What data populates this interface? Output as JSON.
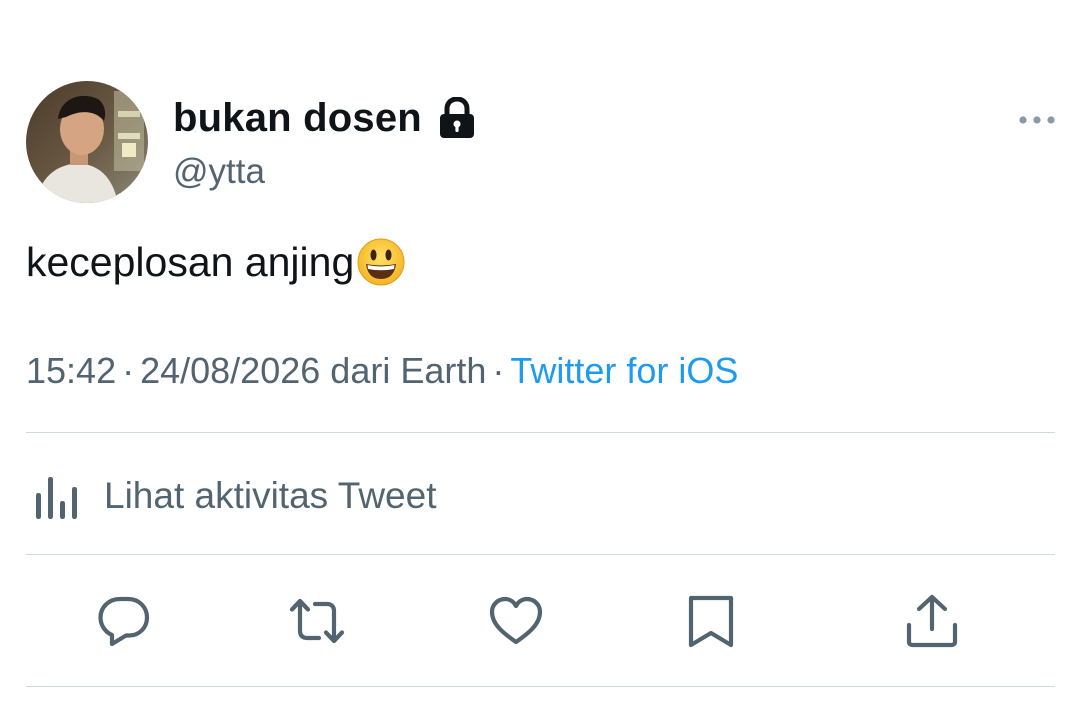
{
  "tweet": {
    "author": {
      "display_name": "bukan dosen",
      "handle": "@ytta",
      "protected_icon": "lock-icon",
      "avatar_icon": "profile-photo"
    },
    "text": "keceplosan anjing",
    "emoji": "grinning-face-emoji",
    "time": "15:42",
    "date": "24/08/2026",
    "location": "dari Earth",
    "separator": "·",
    "source": "Twitter for iOS",
    "activity_label": "Lihat aktivitas Tweet",
    "actions": [
      "reply-icon",
      "retweet-icon",
      "like-icon",
      "bookmark-icon",
      "share-icon"
    ]
  },
  "colors": {
    "text_primary": "#0f1419",
    "text_secondary": "#536471",
    "link": "#1d9bf0",
    "divider": "#cfd9de",
    "emoji_yellow": "#ffcc33"
  }
}
